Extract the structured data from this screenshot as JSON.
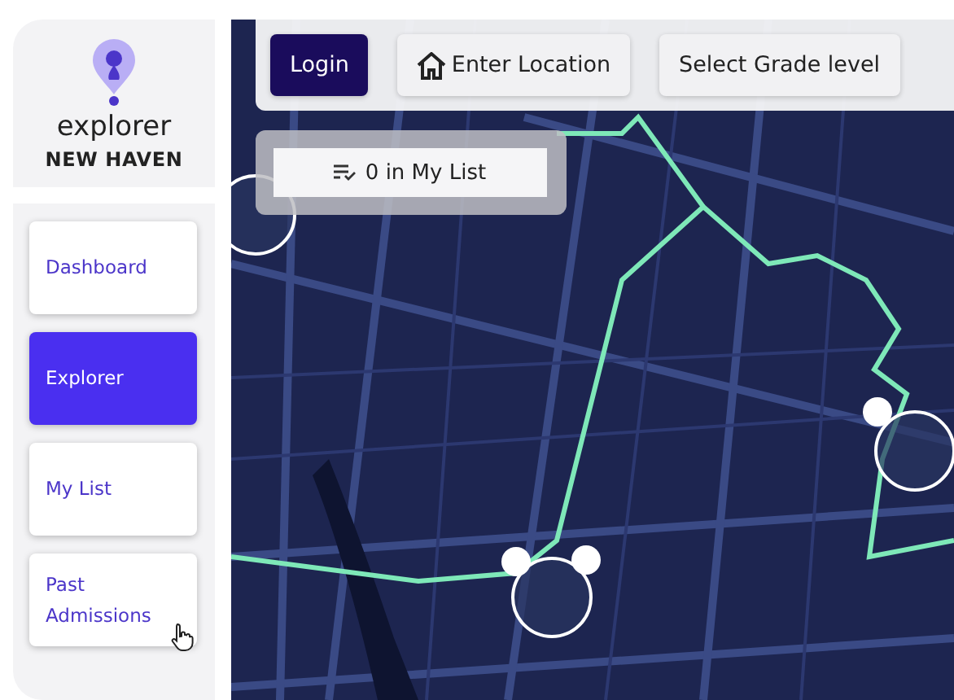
{
  "brand": {
    "name": "explorer",
    "city": "NEW HAVEN"
  },
  "nav": [
    {
      "label": "Dashboard",
      "selected": false
    },
    {
      "label": "Explorer",
      "selected": true
    },
    {
      "label": "My List",
      "selected": false
    },
    {
      "label": "Past Admissions",
      "selected": false
    }
  ],
  "toolbar": [
    {
      "label": "Login",
      "kind": "primary"
    },
    {
      "label": "Enter Location",
      "kind": "location"
    },
    {
      "label": "Select Grade level",
      "kind": "plain"
    }
  ],
  "my_list": {
    "label": "0 in My List"
  }
}
